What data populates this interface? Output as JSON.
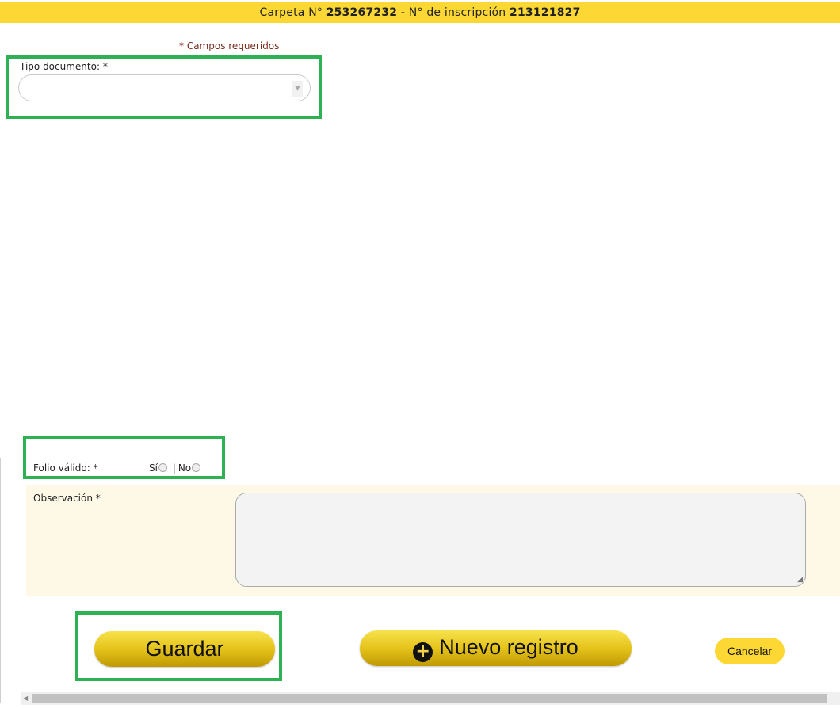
{
  "header": {
    "carpeta_label": "Carpeta N°",
    "carpeta_number": "253267232",
    "separator": "-",
    "inscripcion_label": "N° de inscripción",
    "inscripcion_number": "213121827"
  },
  "form": {
    "required_note": "* Campos requeridos",
    "tipo_documento": {
      "label": "Tipo documento: *",
      "value": ""
    },
    "folio_valido": {
      "label": "Folio válido: *",
      "option_si": "Sí",
      "divider": "|",
      "option_no": "No"
    },
    "observacion": {
      "label": "Observación *",
      "value": ""
    }
  },
  "actions": {
    "save_label": "Guardar",
    "new_record_label": "Nuevo registro",
    "cancel_label": "Cancelar"
  },
  "colors": {
    "header_bg": "#fdd835",
    "highlight_border": "#2eb152",
    "button_gold": "#e5c31a"
  },
  "icons": {
    "new_record": "plus-circle-icon",
    "select_arrow": "chevron-down-icon"
  }
}
